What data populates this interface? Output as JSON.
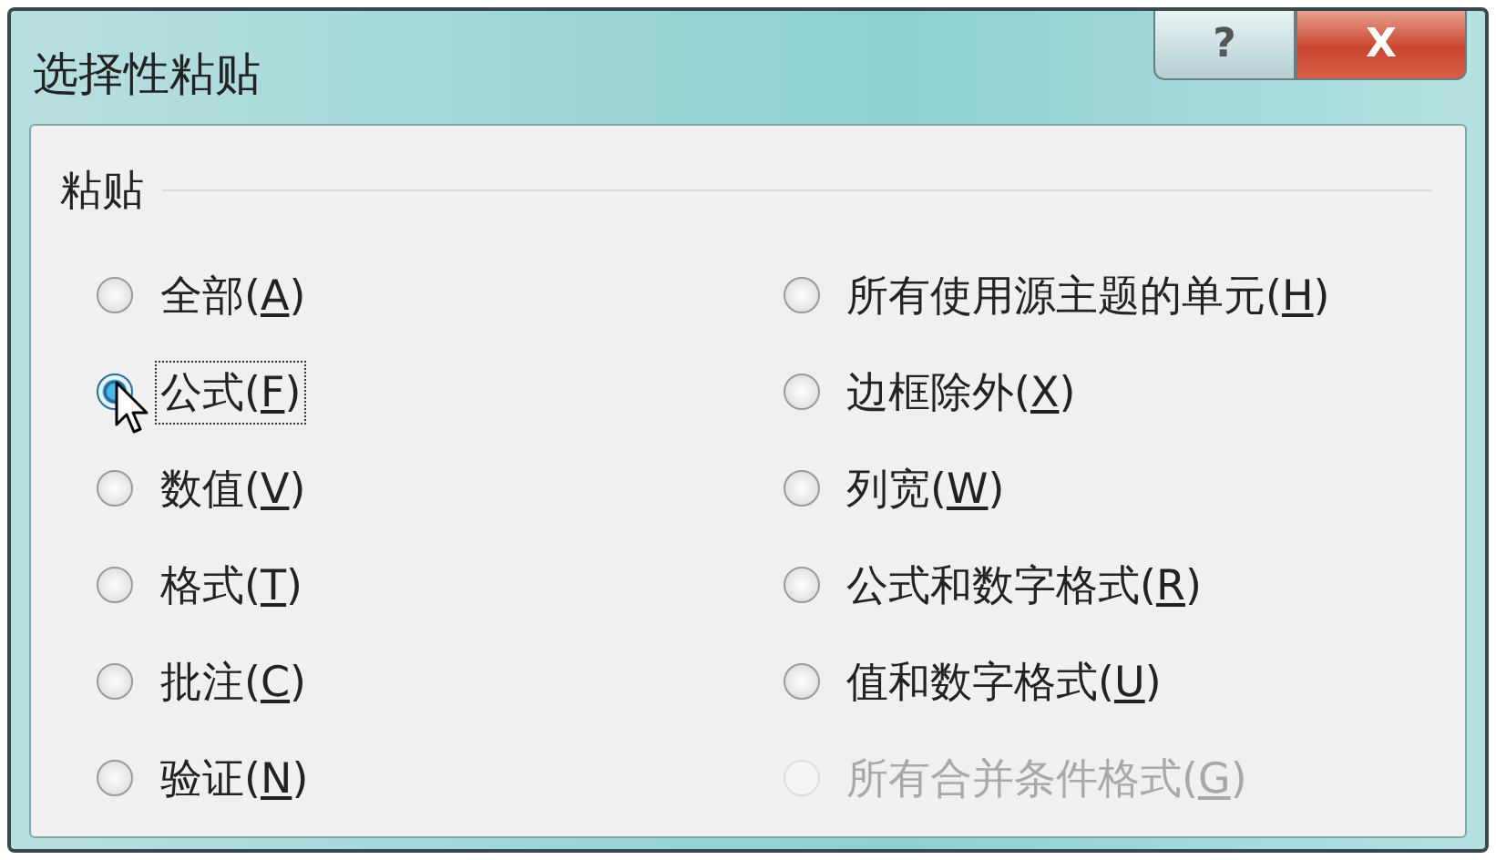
{
  "window": {
    "title": "选择性粘贴",
    "buttons": [
      {
        "kind": "help",
        "label": "?"
      },
      {
        "kind": "close",
        "label": "X"
      }
    ]
  },
  "group": {
    "title": "粘贴"
  },
  "options": [
    {
      "text": "全部(",
      "key": "A",
      "tail": ")",
      "selected": false,
      "focused": false,
      "disabled": false
    },
    {
      "text": "公式(",
      "key": "F",
      "tail": ")",
      "selected": true,
      "focused": true,
      "disabled": false
    },
    {
      "text": "数值(",
      "key": "V",
      "tail": ")",
      "selected": false,
      "focused": false,
      "disabled": false
    },
    {
      "text": "格式(",
      "key": "T",
      "tail": ")",
      "selected": false,
      "focused": false,
      "disabled": false
    },
    {
      "text": "批注(",
      "key": "C",
      "tail": ")",
      "selected": false,
      "focused": false,
      "disabled": false
    },
    {
      "text": "验证(",
      "key": "N",
      "tail": ")",
      "selected": false,
      "focused": false,
      "disabled": false
    },
    {
      "text": "所有使用源主题的单元(",
      "key": "H",
      "tail": ")",
      "selected": false,
      "focused": false,
      "disabled": false
    },
    {
      "text": "边框除外(",
      "key": "X",
      "tail": ")",
      "selected": false,
      "focused": false,
      "disabled": false
    },
    {
      "text": "列宽(",
      "key": "W",
      "tail": ")",
      "selected": false,
      "focused": false,
      "disabled": false
    },
    {
      "text": "公式和数字格式(",
      "key": "R",
      "tail": ")",
      "selected": false,
      "focused": false,
      "disabled": false
    },
    {
      "text": "值和数字格式(",
      "key": "U",
      "tail": ")",
      "selected": false,
      "focused": false,
      "disabled": false
    },
    {
      "text": "所有合并条件格式(",
      "key": "G",
      "tail": ")",
      "selected": false,
      "focused": false,
      "disabled": true
    }
  ]
}
